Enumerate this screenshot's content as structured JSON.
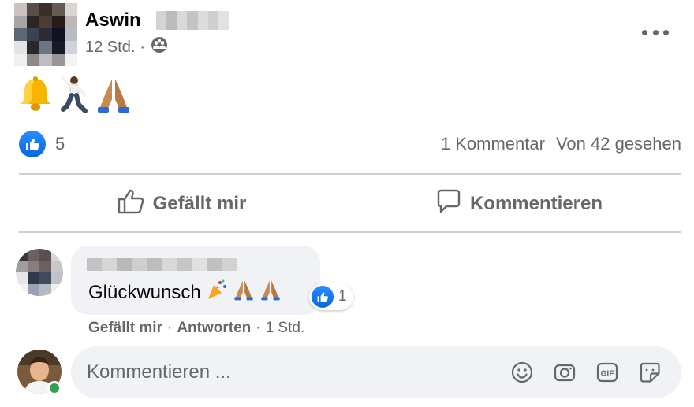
{
  "post": {
    "author_name": "Aswin",
    "timestamp": "12 Std.",
    "separator": "·",
    "audience_icon": "friends-icon",
    "menu_icon": "more-options-icon",
    "emojis": [
      "🔔",
      "🕺",
      "🙏"
    ]
  },
  "stats": {
    "reaction_icon": "like-reaction-icon",
    "like_count": "5",
    "comment_count": "1 Kommentar",
    "view_count": "Von 42 gesehen"
  },
  "actions": {
    "like_label": "Gefällt mir",
    "comment_label": "Kommentieren"
  },
  "comment": {
    "text": "Glückwunsch",
    "emojis": "🎉🙏🙏",
    "reaction_count": "1",
    "like_link": "Gefällt mir",
    "reply_link": "Antworten",
    "sep": "·",
    "time": "1 Std."
  },
  "composer": {
    "placeholder": "Kommentieren ...",
    "icons": [
      "emoji-icon",
      "camera-icon",
      "gif-icon",
      "sticker-icon"
    ]
  },
  "colors": {
    "accent": "#0866ff",
    "text_secondary": "#65676b",
    "bubble_bg": "#f0f2f5",
    "online": "#31a24c"
  }
}
